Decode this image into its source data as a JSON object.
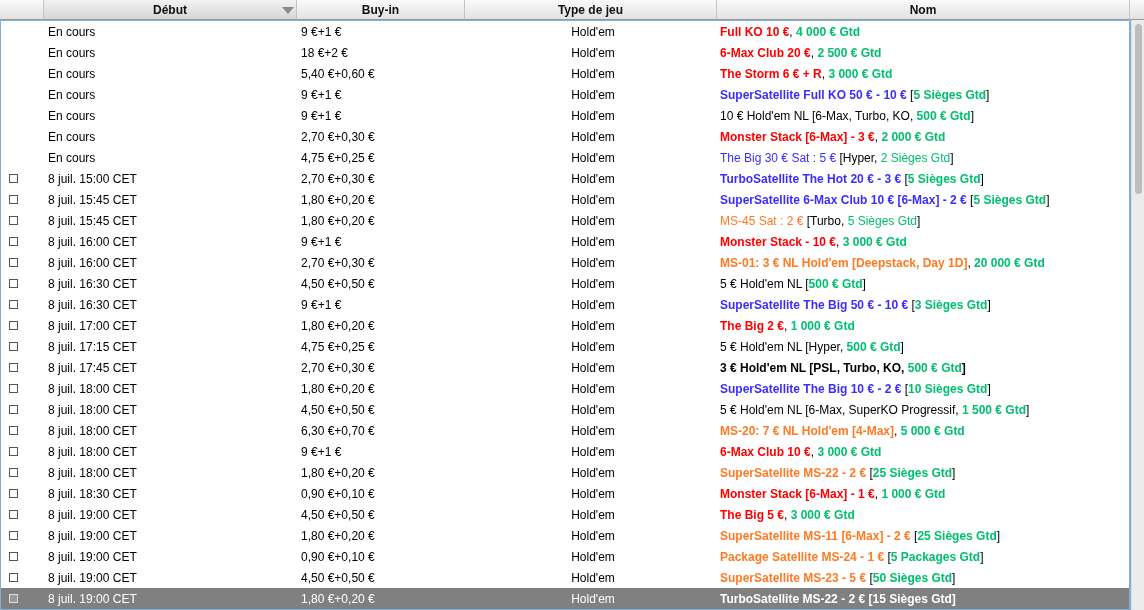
{
  "columns": [
    {
      "sorted": false
    },
    {
      "label": "Début",
      "sorted": true
    },
    {
      "label": "Buy-in",
      "sorted": false
    },
    {
      "label": "Type de jeu",
      "sorted": false
    },
    {
      "label": "Nom",
      "sorted": false
    }
  ],
  "rows": [
    {
      "start": "En cours",
      "buyin": "9 €+1 €",
      "game": "Hold'em",
      "selected": false,
      "name": [
        {
          "text": "Full KO 10 €",
          "color": "#ff0000",
          "bold": true
        },
        {
          "text": ", ",
          "bold": false
        },
        {
          "text": "4 000 € Gtd",
          "color": "#00c070",
          "bold": true
        }
      ]
    },
    {
      "start": "En cours",
      "buyin": "18 €+2 €",
      "game": "Hold'em",
      "selected": false,
      "name": [
        {
          "text": "6-Max Club 20 €",
          "color": "#ff0000",
          "bold": true
        },
        {
          "text": ", ",
          "bold": false
        },
        {
          "text": "2 500 € Gtd",
          "color": "#00c070",
          "bold": true
        }
      ]
    },
    {
      "start": "En cours",
      "buyin": "5,40 €+0,60 €",
      "game": "Hold'em",
      "selected": false,
      "name": [
        {
          "text": "The Storm 6 € + R",
          "color": "#ff0000",
          "bold": true
        },
        {
          "text": ", ",
          "bold": false
        },
        {
          "text": "3 000 € Gtd",
          "color": "#00c070",
          "bold": true
        }
      ]
    },
    {
      "start": "En cours",
      "buyin": "9 €+1 €",
      "game": "Hold'em",
      "selected": false,
      "name": [
        {
          "text": "SuperSatellite Full KO 50 € - 10 €",
          "color": "#3c2cff",
          "bold": true
        },
        {
          "text": " [",
          "bold": false
        },
        {
          "text": "5 Sièges Gtd",
          "color": "#00c070",
          "bold": true
        },
        {
          "text": "]",
          "bold": false
        }
      ]
    },
    {
      "start": "En cours",
      "buyin": "9 €+1 €",
      "game": "Hold'em",
      "selected": false,
      "name": [
        {
          "text": "10 € Hold'em NL [6-Max, Turbo, KO, ",
          "bold": false
        },
        {
          "text": "500 € Gtd",
          "color": "#00c070",
          "bold": true
        },
        {
          "text": "]",
          "bold": false
        }
      ]
    },
    {
      "start": "En cours",
      "buyin": "2,70 €+0,30 €",
      "game": "Hold'em",
      "selected": false,
      "name": [
        {
          "text": "Monster Stack [6-Max] - 3 €",
          "color": "#ff0000",
          "bold": true
        },
        {
          "text": ", ",
          "bold": false
        },
        {
          "text": "2 000 € Gtd",
          "color": "#00c070",
          "bold": true
        }
      ]
    },
    {
      "start": "En cours",
      "buyin": "4,75 €+0,25 €",
      "game": "Hold'em",
      "selected": false,
      "name": [
        {
          "text": "The Big 30 € Sat : 5 €",
          "color": "#3c2cff",
          "bold": false
        },
        {
          "text": "  [Hyper, ",
          "bold": false
        },
        {
          "text": "2 Sièges Gtd",
          "color": "#00c070",
          "bold": false
        },
        {
          "text": "]",
          "bold": false
        }
      ]
    },
    {
      "start": "8 juil. 15:00 CET",
      "checked": false,
      "buyin": "2,70 €+0,30 €",
      "game": "Hold'em",
      "selected": false,
      "name": [
        {
          "text": "TurboSatellite The Hot 20 € - 3 €",
          "color": "#3c2cff",
          "bold": true
        },
        {
          "text": " [",
          "bold": false
        },
        {
          "text": "5 Sièges Gtd",
          "color": "#00c070",
          "bold": true
        },
        {
          "text": "]",
          "bold": false
        }
      ]
    },
    {
      "start": "8 juil. 15:45 CET",
      "checked": false,
      "buyin": "1,80 €+0,20 €",
      "game": "Hold'em",
      "selected": false,
      "name": [
        {
          "text": "SuperSatellite 6-Max Club 10 € [6-Max] - 2 €",
          "color": "#3c2cff",
          "bold": true
        },
        {
          "text": " [",
          "bold": false
        },
        {
          "text": "5 Sièges Gtd",
          "color": "#00c070",
          "bold": true
        },
        {
          "text": "]",
          "bold": false
        }
      ]
    },
    {
      "start": "8 juil. 15:45 CET",
      "checked": false,
      "buyin": "1,80 €+0,20 €",
      "game": "Hold'em",
      "selected": false,
      "name": [
        {
          "text": "MS-45 Sat : 2 €",
          "color": "#ff7a22",
          "bold": false
        },
        {
          "text": "  [Turbo, ",
          "bold": false
        },
        {
          "text": "5 Sièges Gtd",
          "color": "#00c070",
          "bold": false
        },
        {
          "text": "]",
          "bold": false
        }
      ]
    },
    {
      "start": "8 juil. 16:00 CET",
      "checked": false,
      "buyin": "9 €+1 €",
      "game": "Hold'em",
      "selected": false,
      "name": [
        {
          "text": "Monster Stack - 10 €",
          "color": "#ff0000",
          "bold": true
        },
        {
          "text": ", ",
          "bold": false
        },
        {
          "text": "3 000 € Gtd",
          "color": "#00c070",
          "bold": true
        }
      ]
    },
    {
      "start": "8 juil. 16:00 CET",
      "checked": false,
      "buyin": "2,70 €+0,30 €",
      "game": "Hold'em",
      "selected": false,
      "name": [
        {
          "text": "MS-01: 3 € NL Hold'em [Deepstack, Day 1D]",
          "color": "#ff7a22",
          "bold": true
        },
        {
          "text": ", ",
          "bold": false
        },
        {
          "text": "20 000 € Gtd",
          "color": "#00c070",
          "bold": true
        }
      ]
    },
    {
      "start": "8 juil. 16:30 CET",
      "checked": false,
      "buyin": "4,50 €+0,50 €",
      "game": "Hold'em",
      "selected": false,
      "name": [
        {
          "text": "5 € Hold'em NL [",
          "bold": false
        },
        {
          "text": "500 € Gtd",
          "color": "#00c070",
          "bold": true
        },
        {
          "text": "]",
          "bold": false
        }
      ]
    },
    {
      "start": "8 juil. 16:30 CET",
      "checked": false,
      "buyin": "9 €+1 €",
      "game": "Hold'em",
      "selected": false,
      "name": [
        {
          "text": "SuperSatellite The Big 50 € - 10 €",
          "color": "#3c2cff",
          "bold": true
        },
        {
          "text": " [",
          "bold": false
        },
        {
          "text": "3 Sièges Gtd",
          "color": "#00c070",
          "bold": true
        },
        {
          "text": "]",
          "bold": false
        }
      ]
    },
    {
      "start": "8 juil. 17:00 CET",
      "checked": false,
      "buyin": "1,80 €+0,20 €",
      "game": "Hold'em",
      "selected": false,
      "name": [
        {
          "text": "The Big 2 €",
          "color": "#ff0000",
          "bold": true
        },
        {
          "text": ", ",
          "bold": false
        },
        {
          "text": "1 000 € Gtd",
          "color": "#00c070",
          "bold": true
        }
      ]
    },
    {
      "start": "8 juil. 17:15 CET",
      "checked": false,
      "buyin": "4,75 €+0,25 €",
      "game": "Hold'em",
      "selected": false,
      "name": [
        {
          "text": "5 € Hold'em NL [Hyper, ",
          "bold": false
        },
        {
          "text": "500 € Gtd",
          "color": "#00c070",
          "bold": true
        },
        {
          "text": "]",
          "bold": false
        }
      ]
    },
    {
      "start": "8 juil. 17:45 CET",
      "checked": false,
      "buyin": "2,70 €+0,30 €",
      "game": "Hold'em",
      "selected": false,
      "name": [
        {
          "text": "3 € Hold'em NL [PSL, Turbo, KO, ",
          "bold": true
        },
        {
          "text": "500 € Gtd",
          "color": "#00c070",
          "bold": true
        },
        {
          "text": "]",
          "bold": true
        }
      ]
    },
    {
      "start": "8 juil. 18:00 CET",
      "checked": false,
      "buyin": "1,80 €+0,20 €",
      "game": "Hold'em",
      "selected": false,
      "name": [
        {
          "text": "SuperSatellite The Big 10 € - 2 €",
          "color": "#3c2cff",
          "bold": true
        },
        {
          "text": " [",
          "bold": false
        },
        {
          "text": "10 Sièges Gtd",
          "color": "#00c070",
          "bold": true
        },
        {
          "text": "]",
          "bold": false
        }
      ]
    },
    {
      "start": "8 juil. 18:00 CET",
      "checked": false,
      "buyin": "4,50 €+0,50 €",
      "game": "Hold'em",
      "selected": false,
      "name": [
        {
          "text": "5 € Hold'em NL [6-Max, SuperKO Progressif, ",
          "bold": false
        },
        {
          "text": "1 500 € Gtd",
          "color": "#00c070",
          "bold": true
        },
        {
          "text": "]",
          "bold": false
        }
      ]
    },
    {
      "start": "8 juil. 18:00 CET",
      "checked": false,
      "buyin": "6,30 €+0,70 €",
      "game": "Hold'em",
      "selected": false,
      "name": [
        {
          "text": "MS-20: 7 € NL Hold'em [4-Max]",
          "color": "#ff7a22",
          "bold": true
        },
        {
          "text": ", ",
          "bold": false
        },
        {
          "text": "5 000 € Gtd",
          "color": "#00c070",
          "bold": true
        }
      ]
    },
    {
      "start": "8 juil. 18:00 CET",
      "checked": false,
      "buyin": "9 €+1 €",
      "game": "Hold'em",
      "selected": false,
      "name": [
        {
          "text": "6-Max Club 10 €",
          "color": "#ff0000",
          "bold": true
        },
        {
          "text": ", ",
          "bold": false
        },
        {
          "text": "3 000 € Gtd",
          "color": "#00c070",
          "bold": true
        }
      ]
    },
    {
      "start": "8 juil. 18:00 CET",
      "checked": false,
      "buyin": "1,80 €+0,20 €",
      "game": "Hold'em",
      "selected": false,
      "name": [
        {
          "text": "SuperSatellite MS-22 - 2 €",
          "color": "#ff7a22",
          "bold": true
        },
        {
          "text": " [",
          "bold": false
        },
        {
          "text": "25 Sièges Gtd",
          "color": "#00c070",
          "bold": true
        },
        {
          "text": "]",
          "bold": false
        }
      ]
    },
    {
      "start": "8 juil. 18:30 CET",
      "checked": false,
      "buyin": "0,90 €+0,10 €",
      "game": "Hold'em",
      "selected": false,
      "name": [
        {
          "text": "Monster Stack [6-Max] - 1 €",
          "color": "#ff0000",
          "bold": true
        },
        {
          "text": ", ",
          "bold": false
        },
        {
          "text": "1 000 € Gtd",
          "color": "#00c070",
          "bold": true
        }
      ]
    },
    {
      "start": "8 juil. 19:00 CET",
      "checked": false,
      "buyin": "4,50 €+0,50 €",
      "game": "Hold'em",
      "selected": false,
      "name": [
        {
          "text": "The Big 5 €",
          "color": "#ff0000",
          "bold": true
        },
        {
          "text": ", ",
          "bold": false
        },
        {
          "text": "3 000 € Gtd",
          "color": "#00c070",
          "bold": true
        }
      ]
    },
    {
      "start": "8 juil. 19:00 CET",
      "checked": false,
      "buyin": "1,80 €+0,20 €",
      "game": "Hold'em",
      "selected": false,
      "name": [
        {
          "text": "SuperSatellite MS-11 [6-Max] - 2 €",
          "color": "#ff7a22",
          "bold": true
        },
        {
          "text": " [",
          "bold": false
        },
        {
          "text": "25 Sièges Gtd",
          "color": "#00c070",
          "bold": true
        },
        {
          "text": "]",
          "bold": false
        }
      ]
    },
    {
      "start": "8 juil. 19:00 CET",
      "checked": false,
      "buyin": "0,90 €+0,10 €",
      "game": "Hold'em",
      "selected": false,
      "name": [
        {
          "text": "Package Satellite MS-24 - 1 €",
          "color": "#ff7a22",
          "bold": true
        },
        {
          "text": " [",
          "bold": false
        },
        {
          "text": "5 Packages Gtd",
          "color": "#00c070",
          "bold": true
        },
        {
          "text": "]",
          "bold": false
        }
      ]
    },
    {
      "start": "8 juil. 19:00 CET",
      "checked": false,
      "buyin": "4,50 €+0,50 €",
      "game": "Hold'em",
      "selected": false,
      "name": [
        {
          "text": "SuperSatellite MS-23 - 5 €",
          "color": "#ff7a22",
          "bold": true
        },
        {
          "text": " [",
          "bold": false
        },
        {
          "text": "50 Sièges Gtd",
          "color": "#00c070",
          "bold": true
        },
        {
          "text": "]",
          "bold": false
        }
      ]
    },
    {
      "start": "8 juil. 19:00 CET",
      "checked": false,
      "buyin": "1,80 €+0,20 €",
      "game": "Hold'em",
      "selected": true,
      "name": [
        {
          "text": "TurboSatellite MS-22 - 2 € [15 Sièges Gtd]",
          "bold": true
        }
      ]
    }
  ]
}
